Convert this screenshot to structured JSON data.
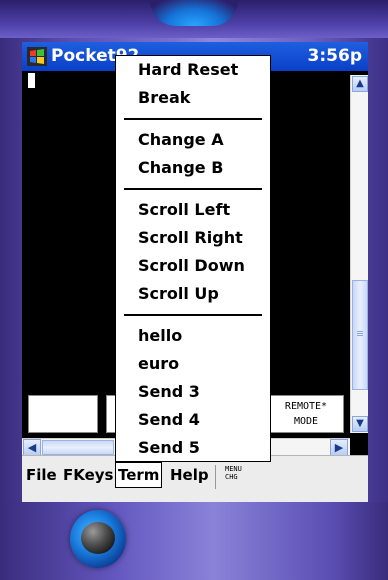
{
  "titlebar": {
    "app": "Pocket92",
    "clock": "3:56p"
  },
  "popup_menu": {
    "groups": [
      [
        "Hard Reset",
        "Break"
      ],
      [
        "Change A",
        "Change B"
      ],
      [
        "Scroll Left",
        "Scroll Right",
        "Scroll Down",
        "Scroll Up"
      ],
      [
        "hello",
        "euro",
        "Send 3",
        "Send 4",
        "Send 5"
      ]
    ]
  },
  "terminal": {
    "mode_line1": "REMOTE*",
    "mode_line2": "MODE"
  },
  "menubar": {
    "file": "File",
    "fkeys": "FKeys",
    "term": "Term",
    "help": "Help",
    "chg_line1": "MENU",
    "chg_line2": "CHG"
  },
  "icons": {
    "start": "windows-flag-icon",
    "scroll_up": "arrow-up-icon",
    "scroll_down": "arrow-down-icon",
    "scroll_left": "arrow-left-icon",
    "scroll_right": "arrow-right-icon"
  },
  "colors": {
    "titlebar": "#0a3fc8",
    "device": "#6a5fc2",
    "menubar": "#ececec"
  }
}
